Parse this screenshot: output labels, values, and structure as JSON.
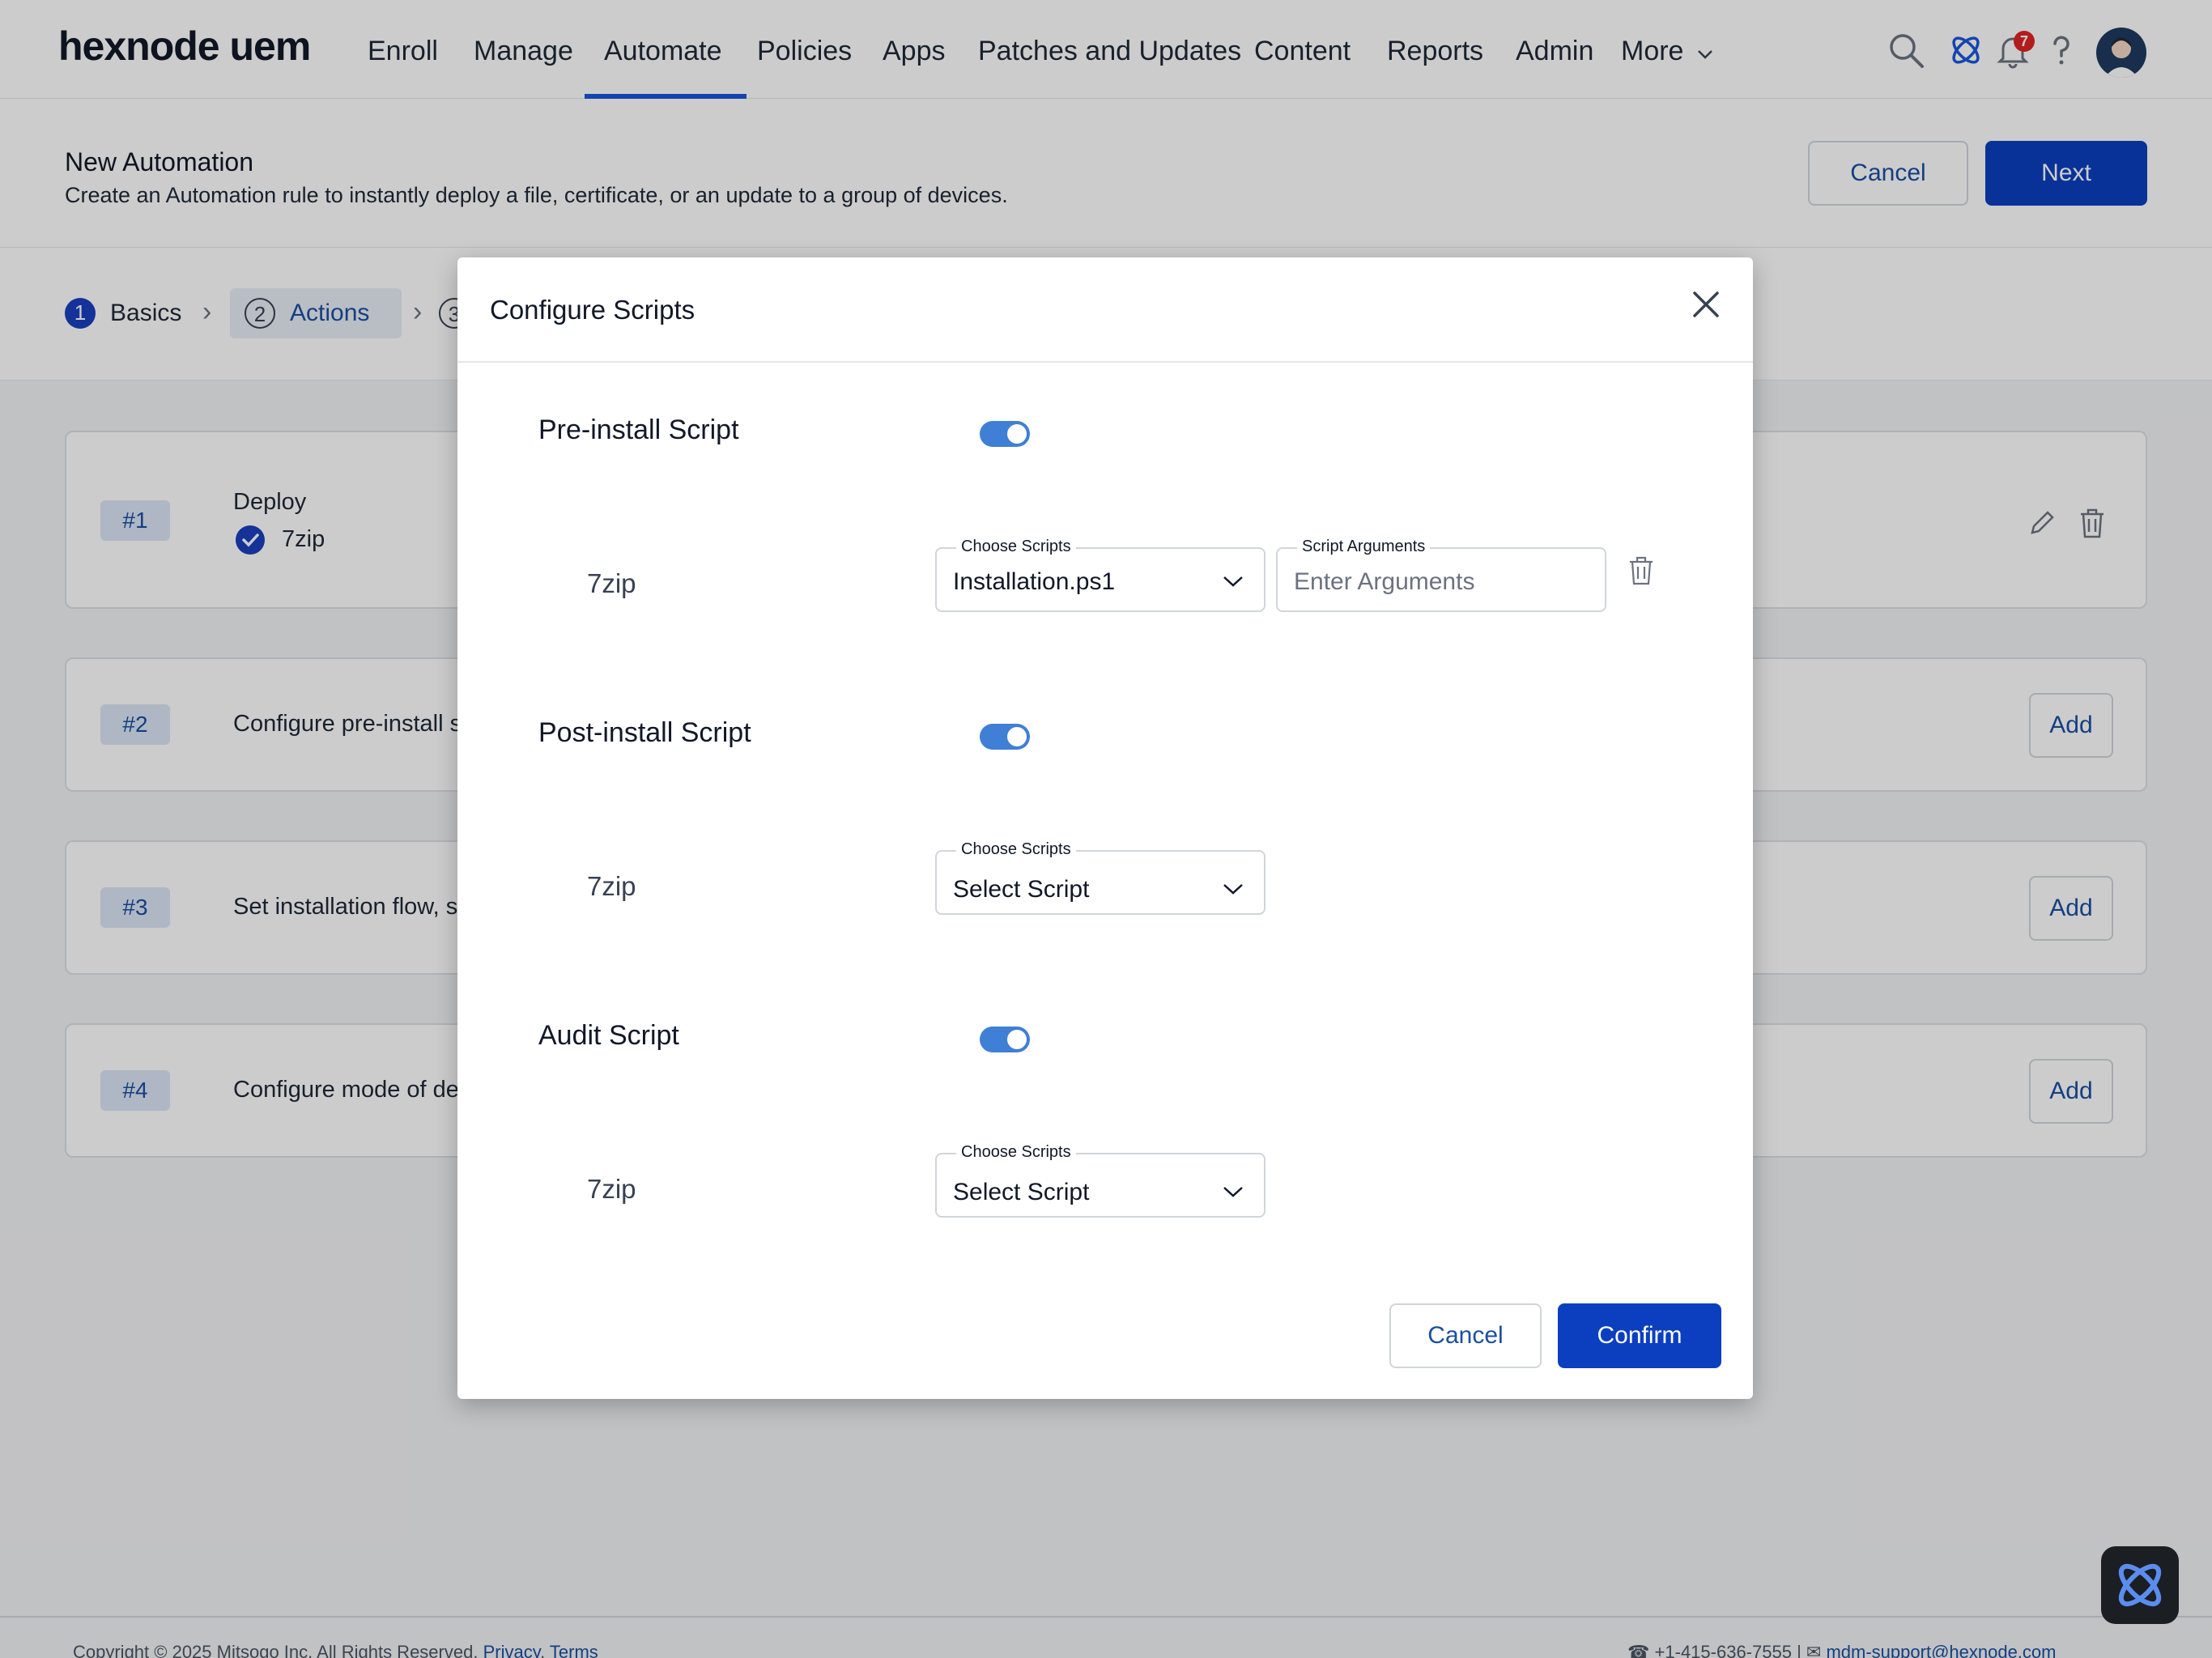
{
  "brand": {
    "logo_text": "hexnode uem",
    "primary": "#0b3fbf",
    "accent": "#1a56db",
    "toggle_on": "#3f7fd6"
  },
  "nav": {
    "items": [
      "Enroll",
      "Manage",
      "Automate",
      "Policies",
      "Apps",
      "Patches and Updates",
      "Content",
      "Reports",
      "Admin",
      "More"
    ],
    "active": "Automate",
    "icons": [
      "search-icon",
      "hexnode-connect-icon",
      "bell-icon",
      "help-icon",
      "avatar"
    ],
    "notification_count": "7"
  },
  "header": {
    "title": "New Automation",
    "subtitle": "Create an Automation rule to instantly deploy a file, certificate, or an update to a group of devices.",
    "cancel": "Cancel",
    "next": "Next"
  },
  "steps": [
    {
      "num": "1",
      "label": "Basics"
    },
    {
      "num": "2",
      "label": "Actions"
    },
    {
      "num": "3",
      "label": ""
    }
  ],
  "actions": [
    {
      "tag": "#1",
      "title": "Deploy",
      "item": "7zip"
    },
    {
      "tag": "#2",
      "text": "Configure pre-install sc",
      "button": "Add"
    },
    {
      "tag": "#3",
      "text": "Set installation flow, su",
      "button": "Add"
    },
    {
      "tag": "#4",
      "text": "Configure mode of dep",
      "button": "Add"
    }
  ],
  "modal": {
    "title": "Configure Scripts",
    "sections": [
      {
        "label": "Pre-install Script",
        "app": "7zip",
        "choose_label": "Choose Scripts",
        "choose_value": "Installation.ps1",
        "args_label": "Script Arguments",
        "args_placeholder": "Enter Arguments"
      },
      {
        "label": "Post-install Script",
        "app": "7zip",
        "choose_label": "Choose Scripts",
        "choose_value": "Select Script"
      },
      {
        "label": "Audit Script",
        "app": "7zip",
        "choose_label": "Choose Scripts",
        "choose_value": "Select Script"
      }
    ],
    "cancel": "Cancel",
    "confirm": "Confirm"
  },
  "footer": {
    "copyright": "Copyright © 2025 Mitsogo Inc. All Rights Reserved.",
    "privacy": "Privacy",
    "terms": "Terms",
    "phone": "+1-415-636-7555",
    "email": "mdm-support@hexnode.com"
  }
}
